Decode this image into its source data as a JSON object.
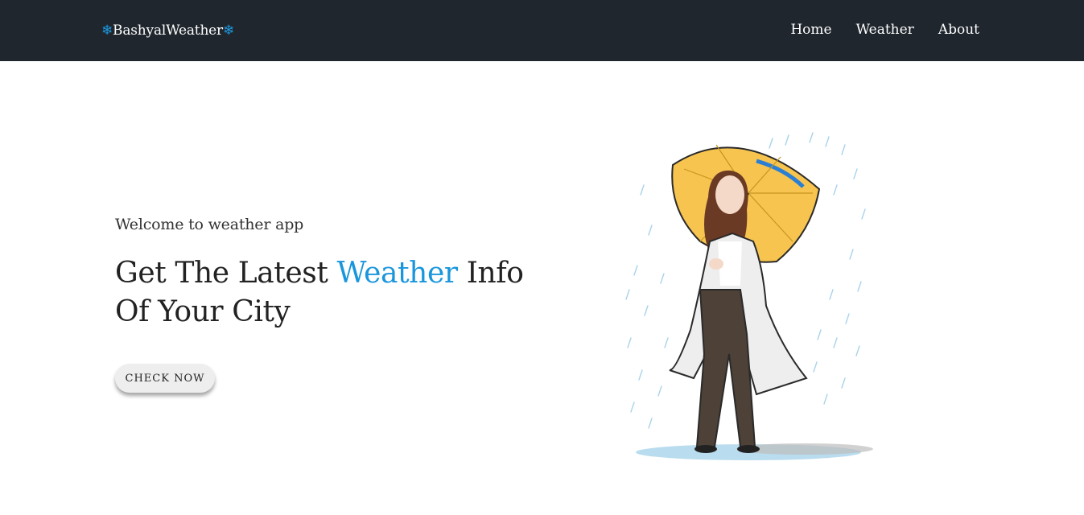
{
  "nav": {
    "brand": "BashyalWeather",
    "brand_icon": "snowflake-icon",
    "links": [
      {
        "label": "Home"
      },
      {
        "label": "Weather"
      },
      {
        "label": "About"
      }
    ]
  },
  "hero": {
    "welcome": "Welcome to weather app",
    "headline_part1": "Get The Latest ",
    "headline_accent": "Weather",
    "headline_part2": " Info Of Your City",
    "cta_label": "CHECK NOW"
  },
  "colors": {
    "navbar_bg": "#1f262e",
    "accent": "#1a96dc",
    "umbrella": "#f7c44f"
  }
}
